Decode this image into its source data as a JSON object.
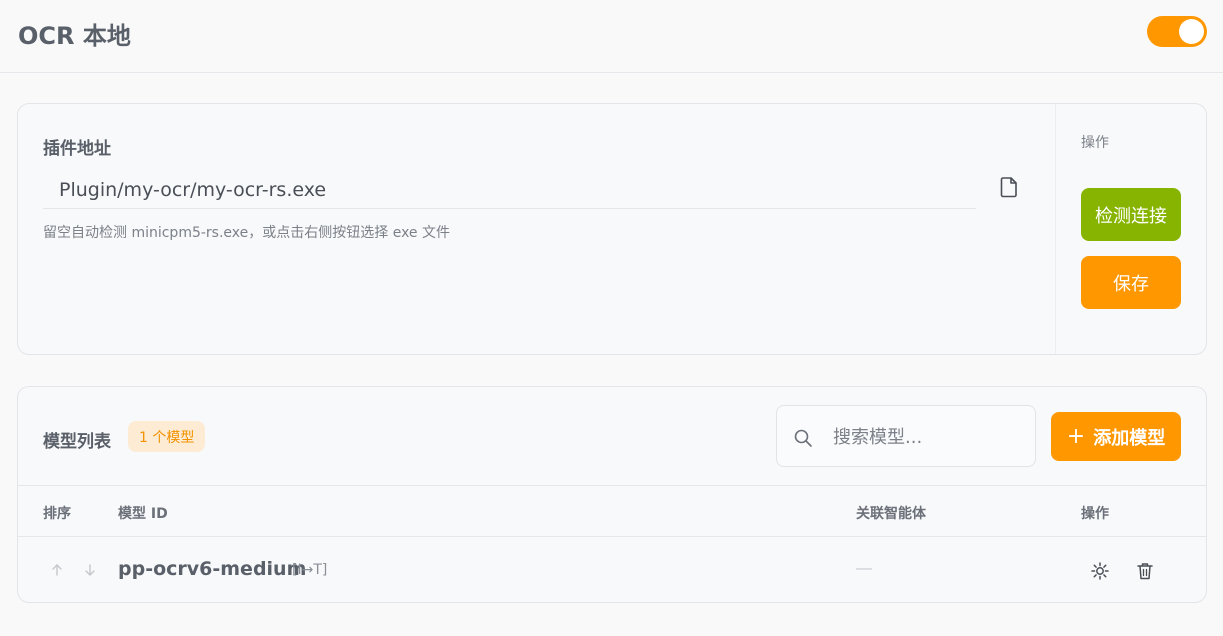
{
  "header": {
    "title": "OCR 本地",
    "toggle_on": true
  },
  "plugin": {
    "label": "插件地址",
    "path_value": "Plugin/my-ocr/my-ocr-rs.exe",
    "hint": "留空自动检测 minicpm5-rs.exe，或点击右侧按钮选择 exe 文件",
    "ops_label": "操作",
    "check_button": "检测连接",
    "save_button": "保存"
  },
  "models": {
    "title": "模型列表",
    "count_badge": "1 个模型",
    "search_placeholder": "搜索模型...",
    "add_button": "添加模型",
    "columns": {
      "order": "排序",
      "model_id": "模型 ID",
      "agents": "关联智能体",
      "actions": "操作"
    },
    "rows": [
      {
        "model_id": "pp-ocrv6-medium",
        "tag": "[I→T]",
        "agents": "—"
      }
    ]
  },
  "colors": {
    "accent_orange": "#ff9700",
    "check_green": "#87b400",
    "badge_bg": "#fdebd4",
    "badge_text": "#f39200"
  },
  "icons": [
    "file-icon",
    "search-icon",
    "plus-icon",
    "arrow-up-icon",
    "arrow-down-icon",
    "settings-icon",
    "trash-icon"
  ]
}
